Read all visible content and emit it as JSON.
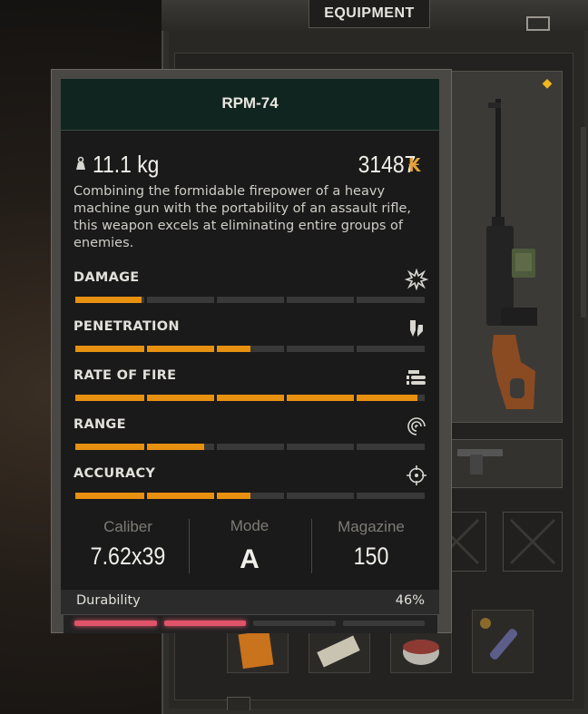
{
  "window": {
    "title": "EQUIPMENT"
  },
  "item": {
    "name": "RPM-74",
    "weight": "11.1 kg",
    "price": "31487",
    "currency_icon": "coin-icon",
    "description": "Combining the formidable firepower of a heavy machine gun with the portability of an assault rifle, this weapon excels at eliminating entire groups of enemies."
  },
  "stats": [
    {
      "label": "DAMAGE",
      "icon": "explosion-icon",
      "fraction": 0.19
    },
    {
      "label": "PENETRATION",
      "icon": "shield-pierce-icon",
      "fraction": 0.5
    },
    {
      "label": "RATE OF FIRE",
      "icon": "bullets-icon",
      "fraction": 0.98
    },
    {
      "label": "RANGE",
      "icon": "range-icon",
      "fraction": 0.37
    },
    {
      "label": "ACCURACY",
      "icon": "crosshair-icon",
      "fraction": 0.5
    }
  ],
  "specs": {
    "caliber_label": "Caliber",
    "caliber": "7.62x39",
    "mode_label": "Mode",
    "mode": "A",
    "magazine_label": "Magazine",
    "magazine": "150"
  },
  "durability": {
    "label": "Durability",
    "value": "46%",
    "fraction": 0.46
  },
  "colors": {
    "accent": "#e8900f",
    "durability": "#e0546a",
    "header_bg": "#102420"
  }
}
